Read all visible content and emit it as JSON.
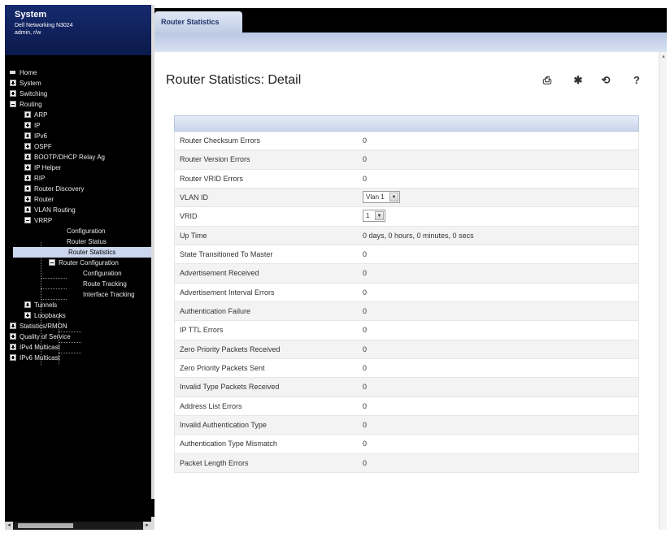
{
  "left_panel": {
    "brand": {
      "title": "System",
      "line1": "Dell Networking N3024",
      "line2": "admin, r/w"
    },
    "tree": [
      {
        "key": "home",
        "label": "Home",
        "exp": "none"
      },
      {
        "key": "system",
        "label": "System",
        "exp": "plus"
      },
      {
        "key": "switching",
        "label": "Switching",
        "exp": "plus"
      },
      {
        "key": "routing",
        "label": "Routing",
        "exp": "minus"
      },
      {
        "key": "arp",
        "label": "ARP",
        "exp": "plus"
      },
      {
        "key": "ip",
        "label": "IP",
        "exp": "plus"
      },
      {
        "key": "ipv6",
        "label": "IPv6",
        "exp": "plus"
      },
      {
        "key": "ospf",
        "label": "OSPF",
        "exp": "plus"
      },
      {
        "key": "bootp",
        "label": "BOOTP/DHCP Relay Ag",
        "exp": "plus"
      },
      {
        "key": "iphelper",
        "label": "IP Helper",
        "exp": "plus"
      },
      {
        "key": "rip",
        "label": "RIP",
        "exp": "plus"
      },
      {
        "key": "routerdiscovery",
        "label": "Router Discovery",
        "exp": "plus"
      },
      {
        "key": "router",
        "label": "Router",
        "exp": "plus"
      },
      {
        "key": "vlanrouting",
        "label": "VLAN Routing",
        "exp": "plus"
      },
      {
        "key": "vrrp",
        "label": "VRRP",
        "exp": "minus"
      },
      {
        "key": "configuration",
        "label": "Configuration",
        "exp": "none"
      },
      {
        "key": "routerstatus",
        "label": "Router Status",
        "exp": "none"
      },
      {
        "key": "routerstatistics",
        "label": "Router Statistics",
        "exp": "none",
        "selected": true
      },
      {
        "key": "routerconfiguration",
        "label": "Router Configuration",
        "exp": "minus"
      },
      {
        "key": "configuration2",
        "label": "Configuration",
        "exp": "none"
      },
      {
        "key": "routetracking",
        "label": "Route Tracking",
        "exp": "none"
      },
      {
        "key": "interfacetracking",
        "label": "Interface Tracking",
        "exp": "none"
      },
      {
        "key": "tunnels",
        "label": "Tunnels",
        "exp": "plus"
      },
      {
        "key": "loopbacks",
        "label": "Loopbacks",
        "exp": "plus"
      },
      {
        "key": "statistics",
        "label": "Statistics/RMON",
        "exp": "plus"
      },
      {
        "key": "qos",
        "label": "Quality of Service",
        "exp": "plus"
      },
      {
        "key": "ipv4multicast",
        "label": "IPv4 Multicast",
        "exp": "plus"
      },
      {
        "key": "ipv6multicast",
        "label": "IPv6 Multicast",
        "exp": "plus"
      }
    ]
  },
  "tab": {
    "label": "Router Statistics"
  },
  "page": {
    "title": "Router Statistics: Detail",
    "toolbar": {
      "help": "?"
    }
  },
  "rows": [
    {
      "label": "Router Checksum Errors",
      "value": "0"
    },
    {
      "label": "Router Version Errors",
      "value": "0"
    },
    {
      "label": "Router VRID Errors",
      "value": "0"
    },
    {
      "label": "VLAN ID",
      "select": "VLAN ID",
      "value": "Vlan 1"
    },
    {
      "label": "VRID",
      "select": "VRID",
      "value": "1"
    },
    {
      "label": "Up Time",
      "value": "0 days, 0 hours, 0 minutes, 0 secs"
    },
    {
      "label": "State Transitioned To Master",
      "value": "0"
    },
    {
      "label": "Advertisement Received",
      "value": "0"
    },
    {
      "label": "Advertisement Interval Errors",
      "value": "0"
    },
    {
      "label": "Authentication Failure",
      "value": "0"
    },
    {
      "label": "IP TTL Errors",
      "value": "0"
    },
    {
      "label": "Zero Priority Packets Received",
      "value": "0"
    },
    {
      "label": "Zero Priority Packets Sent",
      "value": "0"
    },
    {
      "label": "Invalid Type Packets Received",
      "value": "0"
    },
    {
      "label": "Address List Errors",
      "value": "0"
    },
    {
      "label": "Invalid Authentication Type",
      "value": "0"
    },
    {
      "label": "Authentication Type Mismatch",
      "value": "0"
    },
    {
      "label": "Packet Length Errors",
      "value": "0"
    }
  ]
}
